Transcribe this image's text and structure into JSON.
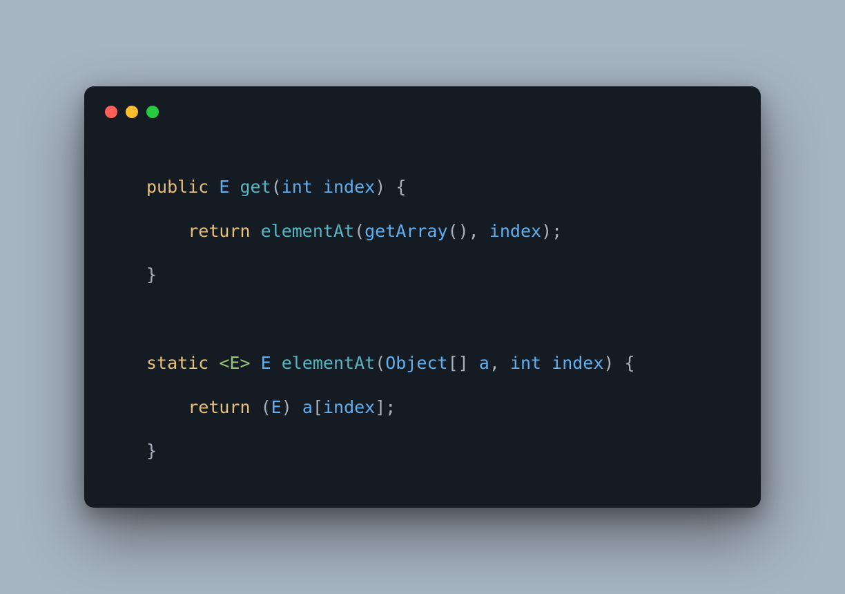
{
  "code": {
    "tokens": [
      [
        {
          "t": "public",
          "c": "tok-keyword"
        },
        {
          "t": " ",
          "c": ""
        },
        {
          "t": "E",
          "c": "tok-type"
        },
        {
          "t": " ",
          "c": ""
        },
        {
          "t": "get",
          "c": "tok-func"
        },
        {
          "t": "(",
          "c": "tok-punc"
        },
        {
          "t": "int",
          "c": "tok-type"
        },
        {
          "t": " ",
          "c": ""
        },
        {
          "t": "index",
          "c": "tok-param"
        },
        {
          "t": ")",
          "c": "tok-punc"
        },
        {
          "t": " ",
          "c": ""
        },
        {
          "t": "{",
          "c": "tok-punc"
        }
      ],
      [
        {
          "t": "    ",
          "c": ""
        },
        {
          "t": "return",
          "c": "tok-keyword"
        },
        {
          "t": " ",
          "c": ""
        },
        {
          "t": "elementAt",
          "c": "tok-func"
        },
        {
          "t": "(",
          "c": "tok-punc"
        },
        {
          "t": "getArray",
          "c": "tok-callfunc"
        },
        {
          "t": "(",
          "c": "tok-punc"
        },
        {
          "t": ")",
          "c": "tok-punc"
        },
        {
          "t": ",",
          "c": "tok-punc"
        },
        {
          "t": " ",
          "c": ""
        },
        {
          "t": "index",
          "c": "tok-param"
        },
        {
          "t": ")",
          "c": "tok-punc"
        },
        {
          "t": ";",
          "c": "tok-punc"
        }
      ],
      [
        {
          "t": "}",
          "c": "tok-punc"
        }
      ],
      [],
      [
        {
          "t": "static",
          "c": "tok-keyword"
        },
        {
          "t": " ",
          "c": ""
        },
        {
          "t": "<E>",
          "c": "tok-generic"
        },
        {
          "t": " ",
          "c": ""
        },
        {
          "t": "E",
          "c": "tok-type"
        },
        {
          "t": " ",
          "c": ""
        },
        {
          "t": "elementAt",
          "c": "tok-func"
        },
        {
          "t": "(",
          "c": "tok-punc"
        },
        {
          "t": "Object",
          "c": "tok-type"
        },
        {
          "t": "[",
          "c": "tok-punc"
        },
        {
          "t": "]",
          "c": "tok-punc"
        },
        {
          "t": " ",
          "c": ""
        },
        {
          "t": "a",
          "c": "tok-param"
        },
        {
          "t": ",",
          "c": "tok-punc"
        },
        {
          "t": " ",
          "c": ""
        },
        {
          "t": "int",
          "c": "tok-type"
        },
        {
          "t": " ",
          "c": ""
        },
        {
          "t": "index",
          "c": "tok-param"
        },
        {
          "t": ")",
          "c": "tok-punc"
        },
        {
          "t": " ",
          "c": ""
        },
        {
          "t": "{",
          "c": "tok-punc"
        }
      ],
      [
        {
          "t": "    ",
          "c": ""
        },
        {
          "t": "return",
          "c": "tok-keyword"
        },
        {
          "t": " ",
          "c": ""
        },
        {
          "t": "(",
          "c": "tok-punc"
        },
        {
          "t": "E",
          "c": "tok-type"
        },
        {
          "t": ")",
          "c": "tok-punc"
        },
        {
          "t": " ",
          "c": ""
        },
        {
          "t": "a",
          "c": "tok-param"
        },
        {
          "t": "[",
          "c": "tok-punc"
        },
        {
          "t": "index",
          "c": "tok-param"
        },
        {
          "t": "]",
          "c": "tok-punc"
        },
        {
          "t": ";",
          "c": "tok-punc"
        }
      ],
      [
        {
          "t": "}",
          "c": "tok-punc"
        }
      ]
    ]
  }
}
